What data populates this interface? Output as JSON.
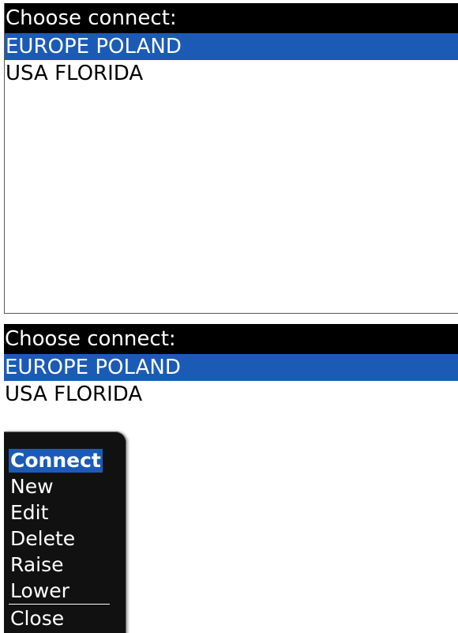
{
  "screens": [
    {
      "title": "Choose connect:",
      "items": [
        {
          "label": "EUROPE POLAND",
          "selected": true
        },
        {
          "label": "USA FLORIDA",
          "selected": false
        }
      ]
    },
    {
      "title": "Choose connect:",
      "items": [
        {
          "label": "EUROPE POLAND",
          "selected": true
        },
        {
          "label": "USA FLORIDA",
          "selected": false
        }
      ],
      "menu": {
        "items": [
          {
            "label": "Connect",
            "selected": true
          },
          {
            "label": "New",
            "selected": false
          },
          {
            "label": "Edit",
            "selected": false
          },
          {
            "label": "Delete",
            "selected": false
          },
          {
            "label": "Raise",
            "selected": false
          },
          {
            "label": "Lower",
            "selected": false
          },
          {
            "label": "Close",
            "selected": false
          }
        ]
      }
    }
  ],
  "colors": {
    "title_bar_bg": "#000000",
    "selection": "#1b5bb5",
    "menu_bg": "#111111",
    "text": "#000000",
    "text_inverse": "#ffffff"
  }
}
